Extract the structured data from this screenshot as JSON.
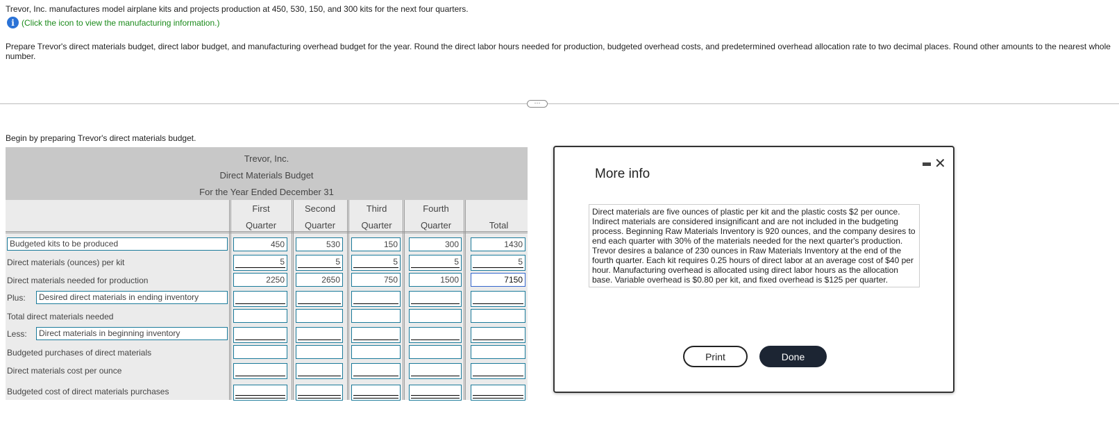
{
  "intro": "Trevor, Inc. manufactures model airplane kits and projects production at 450, 530, 150, and 300 kits for the next four quarters.",
  "info_link": "(Click the icon to view the manufacturing information.)",
  "instructions": "Prepare Trevor's direct materials budget, direct labor budget, and manufacturing overhead budget for the year. Round the direct labor hours needed for production, budgeted overhead costs, and predetermined overhead allocation rate to two decimal places. Round other amounts to the nearest whole number.",
  "divider_dots": "···",
  "begin": "Begin by preparing Trevor's direct materials budget.",
  "table": {
    "company": "Trevor, Inc.",
    "title": "Direct Materials Budget",
    "period": "For the Year Ended December 31",
    "columns": [
      [
        "First",
        "Quarter"
      ],
      [
        "Second",
        "Quarter"
      ],
      [
        "Third",
        "Quarter"
      ],
      [
        "Fourth",
        "Quarter"
      ],
      [
        "",
        "Total"
      ]
    ],
    "rows": [
      {
        "label": "Budgeted kits to be produced",
        "values": [
          "450",
          "530",
          "150",
          "300",
          "1430"
        ]
      },
      {
        "label": "Direct materials (ounces) per kit",
        "values": [
          "5",
          "5",
          "5",
          "5",
          "5"
        ]
      },
      {
        "label": "Direct materials needed for production",
        "values": [
          "2250",
          "2650",
          "750",
          "1500",
          "7150"
        ]
      },
      {
        "prefix": "Plus:",
        "label": "Desired direct materials in ending inventory",
        "values": [
          "",
          "",
          "",
          "",
          ""
        ]
      },
      {
        "label": "Total direct materials needed",
        "values": [
          "",
          "",
          "",
          "",
          ""
        ]
      },
      {
        "prefix": "Less:",
        "label": "Direct materials in beginning inventory",
        "values": [
          "",
          "",
          "",
          "",
          ""
        ]
      },
      {
        "label": "Budgeted purchases of direct materials",
        "values": [
          "",
          "",
          "",
          "",
          ""
        ]
      },
      {
        "label": "Direct materials cost per ounce",
        "values": [
          "",
          "",
          "",
          "",
          ""
        ]
      },
      {
        "label": "Budgeted cost of direct materials purchases",
        "values": [
          "",
          "",
          "",
          "",
          ""
        ]
      }
    ]
  },
  "modal": {
    "title": "More info",
    "text": "Direct materials are five ounces of plastic per kit and the plastic costs $2 per ounce. Indirect materials are considered insignificant and are not included in the budgeting process. Beginning Raw Materials Inventory is 920 ounces, and the company desires to end each quarter with 30% of the materials needed for the next quarter's production. Trevor desires a balance of 230 ounces in Raw Materials Inventory at the end of the fourth quarter. Each kit requires 0.25 hours of direct labor at an average cost of $40 per hour. Manufacturing overhead is allocated using direct labor hours as the allocation base. Variable overhead is $0.80 per kit, and fixed overhead is $125 per quarter.",
    "print": "Print",
    "done": "Done",
    "close": "✕"
  }
}
